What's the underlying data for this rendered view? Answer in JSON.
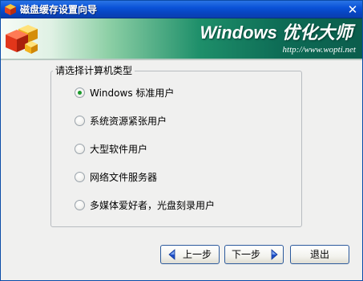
{
  "window": {
    "title": "磁盘缓存设置向导",
    "close_symbol": "✕",
    "title_icon": "app-cube-icon"
  },
  "banner": {
    "brand": "Windows 优化大师",
    "url": "http://www.wopti.net",
    "logo_icon": "cubes-logo-icon"
  },
  "group": {
    "legend": "请选择计算机类型",
    "options": [
      {
        "label": "Windows 标准用户",
        "checked": true
      },
      {
        "label": "系统资源紧张用户",
        "checked": false
      },
      {
        "label": "大型软件用户",
        "checked": false
      },
      {
        "label": "网络文件服务器",
        "checked": false
      },
      {
        "label": "多媒体爱好者，光盘刻录用户",
        "checked": false
      }
    ]
  },
  "buttons": {
    "prev_label": "上一步",
    "next_label": "下一步",
    "exit_label": "退出",
    "arrow_color": "#1e4fc8"
  },
  "colors": {
    "titlebar": "#0a52d8",
    "banner_dark": "#0b5d4c",
    "radio_selected": "#1a9a2a"
  }
}
